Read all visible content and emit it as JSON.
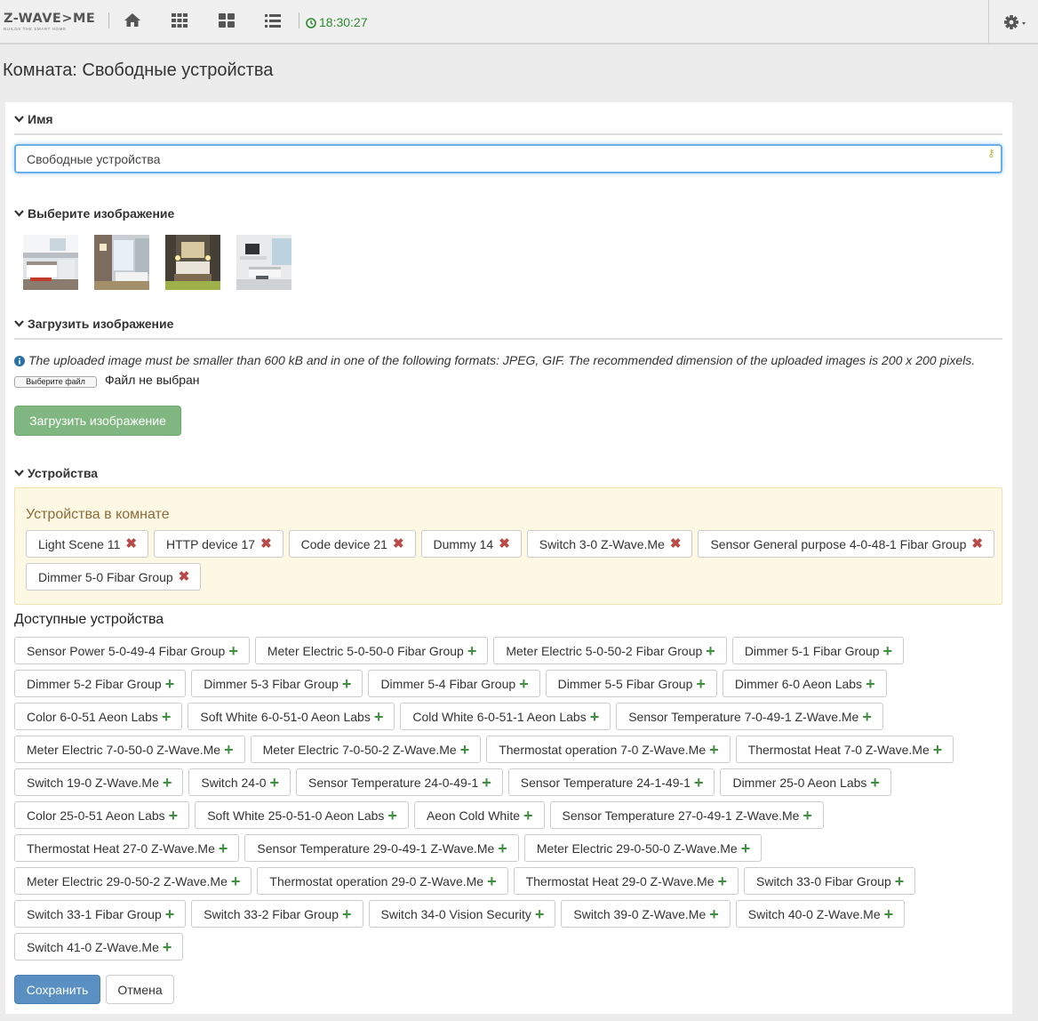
{
  "topbar": {
    "logo_text": "Z-WAVE>ME",
    "logo_tagline": "BUILDS THE SMART HOME",
    "nav_icons": [
      "home-icon",
      "apps-grid-icon",
      "dashboard-icon",
      "list-icon"
    ],
    "time": "18:30:27",
    "settings_icon": "gear-icon"
  },
  "page": {
    "title": "Комната: Свободные устройства"
  },
  "name_section": {
    "heading": "Имя",
    "value": "Свободные устройства"
  },
  "image_section": {
    "heading": "Выберите изображение",
    "thumbnails": [
      "kitchen",
      "bathroom",
      "bedroom",
      "living-room"
    ]
  },
  "upload_section": {
    "heading": "Загрузить изображение",
    "info_text": "The uploaded image must be smaller than 600 kB and in one of the following formats: JPEG, GIF. The recommended dimension of the uploaded images is 200 x 200 pixels.",
    "choose_file_label": "Выберите файл",
    "file_status": "Файл не выбран",
    "upload_button": "Загрузить изображение"
  },
  "devices_section": {
    "heading": "Устройства",
    "in_room_title": "Устройства в комнате",
    "in_room": [
      "Light Scene 11",
      "HTTP device 17",
      "Code device 21",
      "Dummy 14",
      "Switch 3-0 Z-Wave.Me",
      "Sensor General purpose 4-0-48-1 Fibar Group",
      "Dimmer 5-0 Fibar Group"
    ],
    "available_title": "Доступные устройства",
    "available": [
      "Sensor Power 5-0-49-4 Fibar Group",
      "Meter Electric 5-0-50-0 Fibar Group",
      "Meter Electric 5-0-50-2 Fibar Group",
      "Dimmer 5-1 Fibar Group",
      "Dimmer 5-2 Fibar Group",
      "Dimmer 5-3 Fibar Group",
      "Dimmer 5-4 Fibar Group",
      "Dimmer 5-5 Fibar Group",
      "Dimmer 6-0 Aeon Labs",
      "Color 6-0-51 Aeon Labs",
      "Soft White 6-0-51-0 Aeon Labs",
      "Cold White 6-0-51-1 Aeon Labs",
      "Sensor Temperature 7-0-49-1 Z-Wave.Me",
      "Meter Electric 7-0-50-0 Z-Wave.Me",
      "Meter Electric 7-0-50-2 Z-Wave.Me",
      "Thermostat operation 7-0 Z-Wave.Me",
      "Thermostat Heat 7-0 Z-Wave.Me",
      "Switch 19-0 Z-Wave.Me",
      "Switch 24-0",
      "Sensor Temperature 24-0-49-1",
      "Sensor Temperature 24-1-49-1",
      "Dimmer 25-0 Aeon Labs",
      "Color 25-0-51 Aeon Labs",
      "Soft White 25-0-51-0 Aeon Labs",
      "Aeon Cold White",
      "Sensor Temperature 27-0-49-1 Z-Wave.Me",
      "Thermostat Heat 27-0 Z-Wave.Me",
      "Sensor Temperature 29-0-49-1 Z-Wave.Me",
      "Meter Electric 29-0-50-0 Z-Wave.Me",
      "Meter Electric 29-0-50-2 Z-Wave.Me",
      "Thermostat operation 29-0 Z-Wave.Me",
      "Thermostat Heat 29-0 Z-Wave.Me",
      "Switch 33-0 Fibar Group",
      "Switch 33-1 Fibar Group",
      "Switch 33-2 Fibar Group",
      "Switch 34-0 Vision Security",
      "Switch 39-0 Z-Wave.Me",
      "Switch 40-0 Z-Wave.Me",
      "Switch 41-0 Z-Wave.Me"
    ]
  },
  "actions": {
    "save": "Сохранить",
    "cancel": "Отмена"
  },
  "colors": {
    "accent_green": "#2c8a2c",
    "remove_red": "#b94a48",
    "add_green": "#3e8f3e",
    "primary_blue": "#5a8fc2",
    "warning_bg": "#fcf8e3"
  }
}
